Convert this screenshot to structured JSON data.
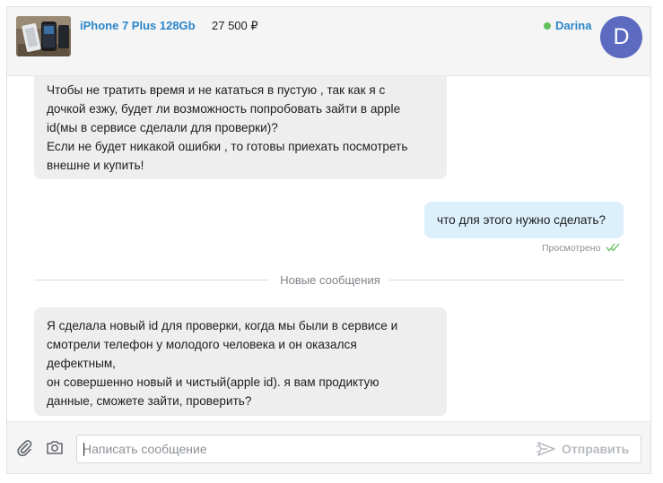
{
  "header": {
    "product_title": "iPhone 7 Plus 128Gb",
    "product_price": "27 500 ₽",
    "user_name": "Darina",
    "avatar_letter": "D",
    "online_color": "#62c05b",
    "avatar_color": "#5c6bc0"
  },
  "messages": [
    {
      "direction": "incoming",
      "lines": [
        "Чтобы не тратить время и не кататься в пустую , так как я с",
        "дочкой езжу, будет ли возможность попробовать зайти в apple",
        "id(мы в сервисе сделали для проверки)?",
        "Если не будет никакой ошибки , то готовы приехать посмотреть",
        "внешне и купить!"
      ]
    },
    {
      "direction": "outgoing",
      "lines": [
        "что для этого нужно сделать?"
      ],
      "status": "Просмотрено",
      "status_icon": "double-check-icon"
    },
    {
      "direction": "incoming",
      "lines": [
        "Я сделала новый id для проверки, когда мы были в сервисе и",
        "смотрели телефон у молодого человека и он оказался",
        "дефектным,",
        "он совершенно новый и чистый(apple id). я вам продиктую",
        "данные, сможете зайти, проверить?"
      ]
    }
  ],
  "divider": {
    "label": "Новые сообщения"
  },
  "composer": {
    "placeholder": "Написать сообщение",
    "value": "",
    "send_label": "Отправить",
    "icons": [
      "paperclip-icon",
      "camera-icon",
      "send-plane-icon"
    ]
  }
}
